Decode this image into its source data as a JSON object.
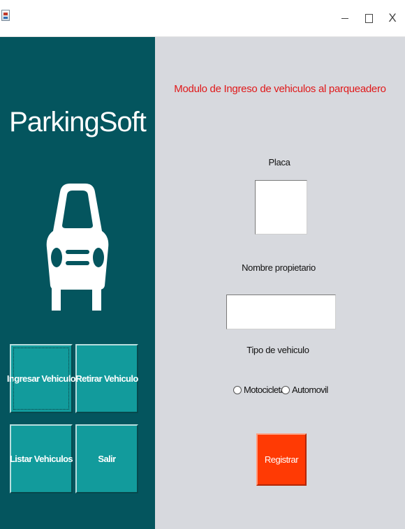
{
  "window": {
    "controls": {
      "minimize_icon": "minimize-icon",
      "maximize_icon": "maximize-icon",
      "close_label": "X"
    }
  },
  "sidebar": {
    "brand": "ParkingSoft",
    "icon": "car-front-icon",
    "buttons": [
      {
        "label": "Ingresar Vehiculo"
      },
      {
        "label": "Retirar Vehiculo"
      },
      {
        "label": "Listar Vehiculos"
      },
      {
        "label": "Salir"
      }
    ]
  },
  "form": {
    "title": "Modulo de Ingreso de vehiculos al parqueadero",
    "placa_label": "Placa",
    "placa_value": "",
    "nombre_label": "Nombre propietario",
    "nombre_value": "",
    "tipo_label": "Tipo de vehiculo",
    "tipo_options": [
      {
        "label": "Motocicleta",
        "selected": false
      },
      {
        "label": "Automovil",
        "selected": false
      }
    ],
    "submit_label": "Registrar"
  },
  "colors": {
    "sidebar_bg": "#04555e",
    "nav_button_bg": "#129b9c",
    "content_bg": "#d7d9de",
    "title_red": "#e0191a",
    "submit_bg": "#ff3a04"
  }
}
